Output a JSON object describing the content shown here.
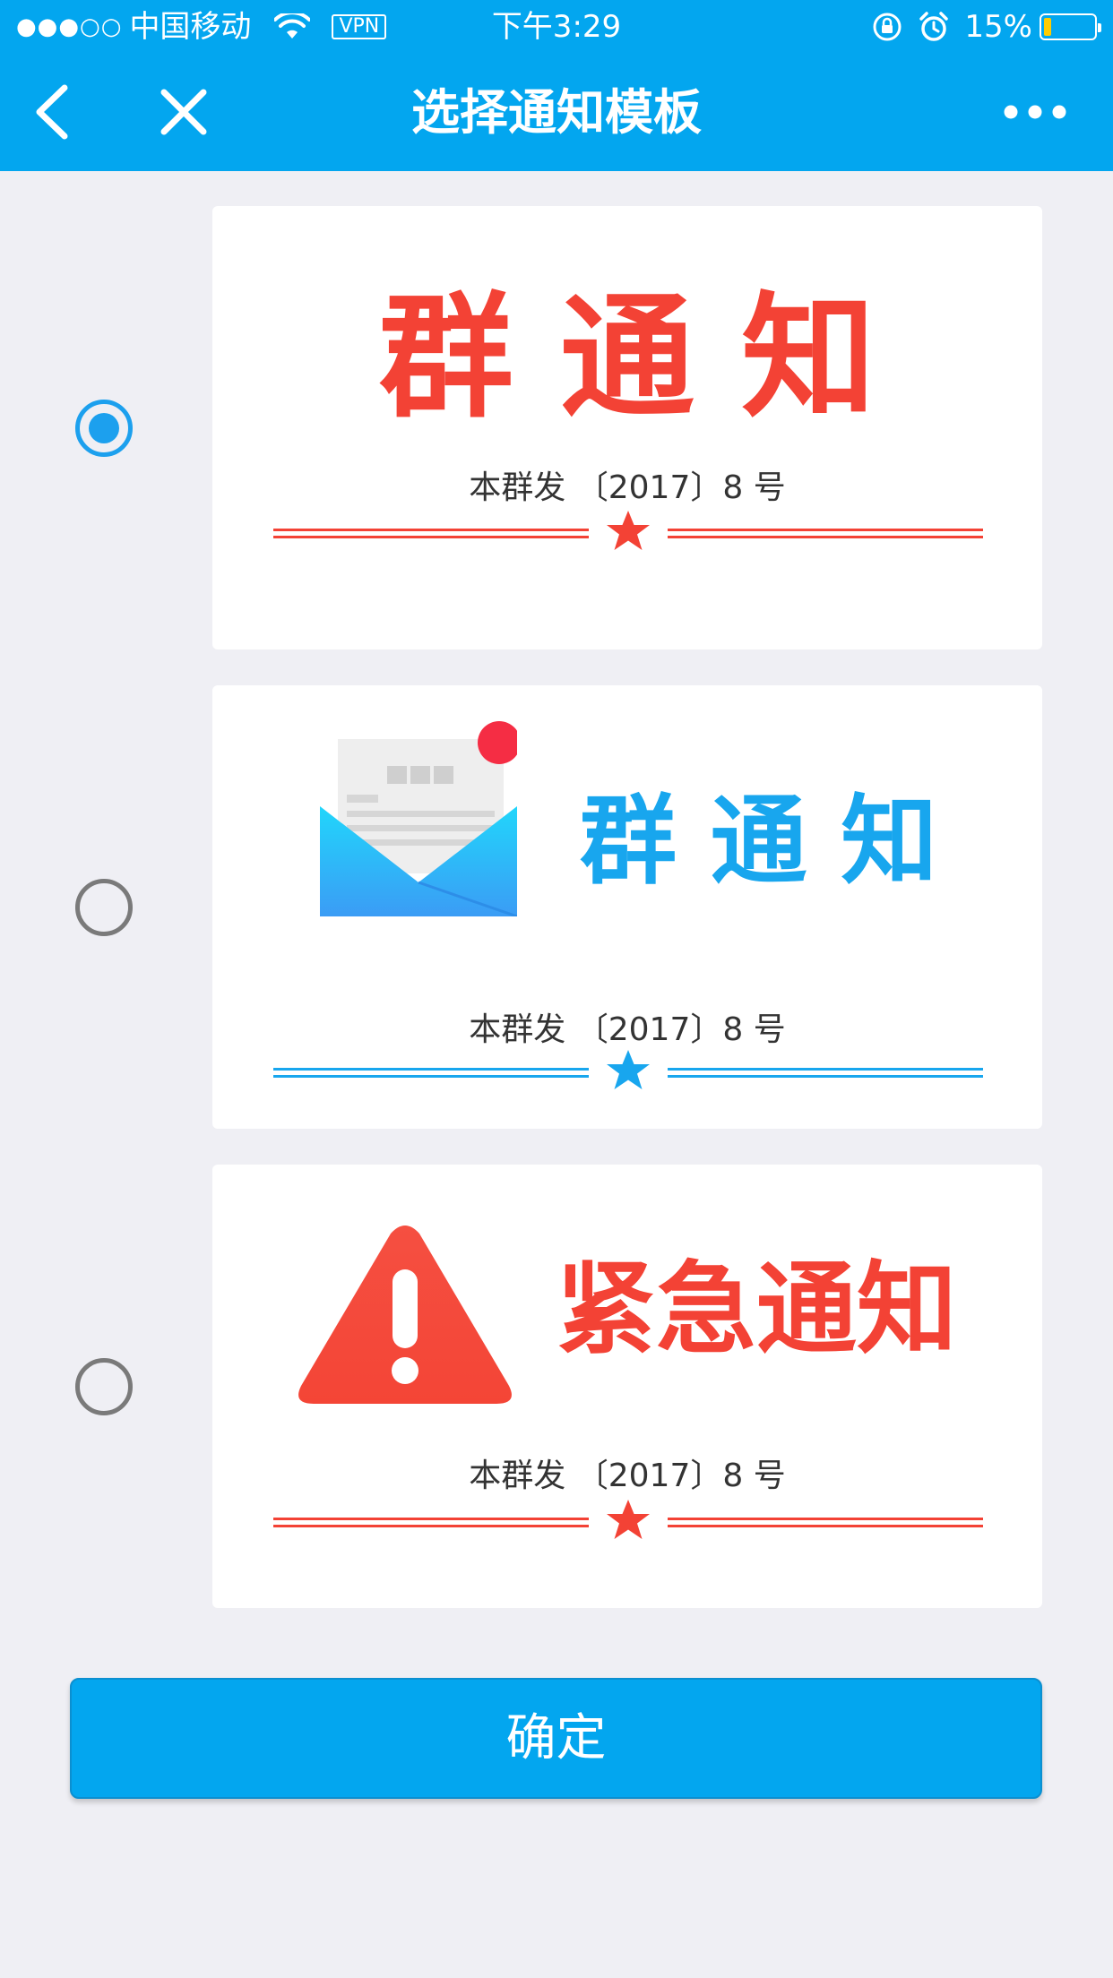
{
  "status_bar": {
    "signal": "●●●○○",
    "carrier": "中国移动",
    "vpn": "VPN",
    "time": "下午3:29",
    "battery_percent": "15%",
    "battery_level": 0.15,
    "battery_color": "#ffcc00"
  },
  "nav": {
    "title": "选择通知模板",
    "back_icon": "chevron-left-icon",
    "close_icon": "close-icon",
    "more_icon": "more-icon"
  },
  "templates": [
    {
      "title": "群 通 知",
      "doc_number": "本群发 〔2017〕8  号",
      "color": "#f34235",
      "selected": true,
      "icon": ""
    },
    {
      "title": "群 通 知",
      "doc_number": "本群发 〔2017〕8  号",
      "color": "#18a6ee",
      "selected": false,
      "icon": "envelope-icon"
    },
    {
      "title": "紧急通知",
      "doc_number": "本群发 〔2017〕8  号",
      "color": "#f34235",
      "selected": false,
      "icon": "warning-icon"
    }
  ],
  "confirm": {
    "label": "确定"
  },
  "colors": {
    "accent": "#03a6ef",
    "background": "#efeff4"
  }
}
